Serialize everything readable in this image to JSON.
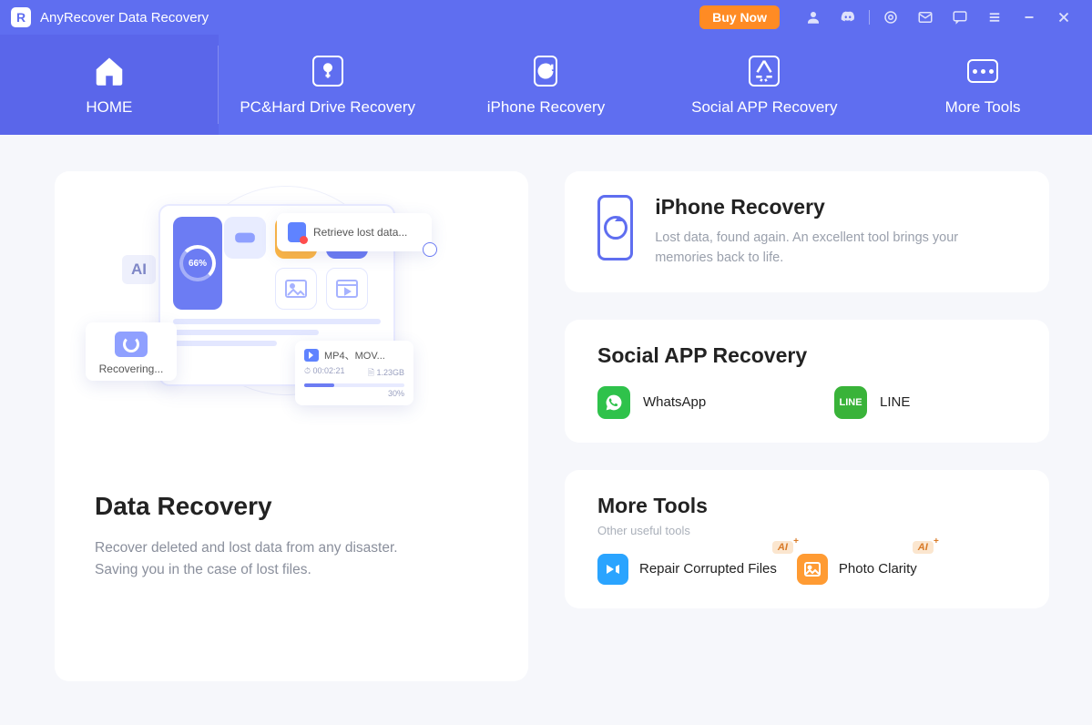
{
  "titlebar": {
    "logo_letter": "R",
    "title": "AnyRecover Data Recovery",
    "buy_label": "Buy Now"
  },
  "nav": {
    "home": "HOME",
    "pc": "PC&Hard Drive Recovery",
    "iphone": "iPhone Recovery",
    "social": "Social APP Recovery",
    "more": "More Tools"
  },
  "hero": {
    "title": "Data Recovery",
    "desc": "Recover deleted and lost data from any disaster. Saving you in the case of lost files.",
    "ai_badge": "AI",
    "gauge_pct": "66%",
    "pop_retrieve": "Retrieve lost data...",
    "pop_recovering": "Recovering...",
    "pop_video_name": "MP4、MOV...",
    "pop_video_time": "00:02:21",
    "pop_video_size": "1.23GB",
    "pop_video_pct": "30%"
  },
  "iphone_card": {
    "title": "iPhone Recovery",
    "desc": "Lost data, found again. An excellent tool brings your memories back to life."
  },
  "social_card": {
    "title": "Social APP Recovery",
    "whatsapp": "WhatsApp",
    "line": "LINE",
    "line_icon_text": "LINE"
  },
  "tools_card": {
    "title": "More Tools",
    "sub": "Other useful tools",
    "repair": "Repair Corrupted Files",
    "clarity": "Photo Clarity",
    "ai_badge": "AI"
  }
}
